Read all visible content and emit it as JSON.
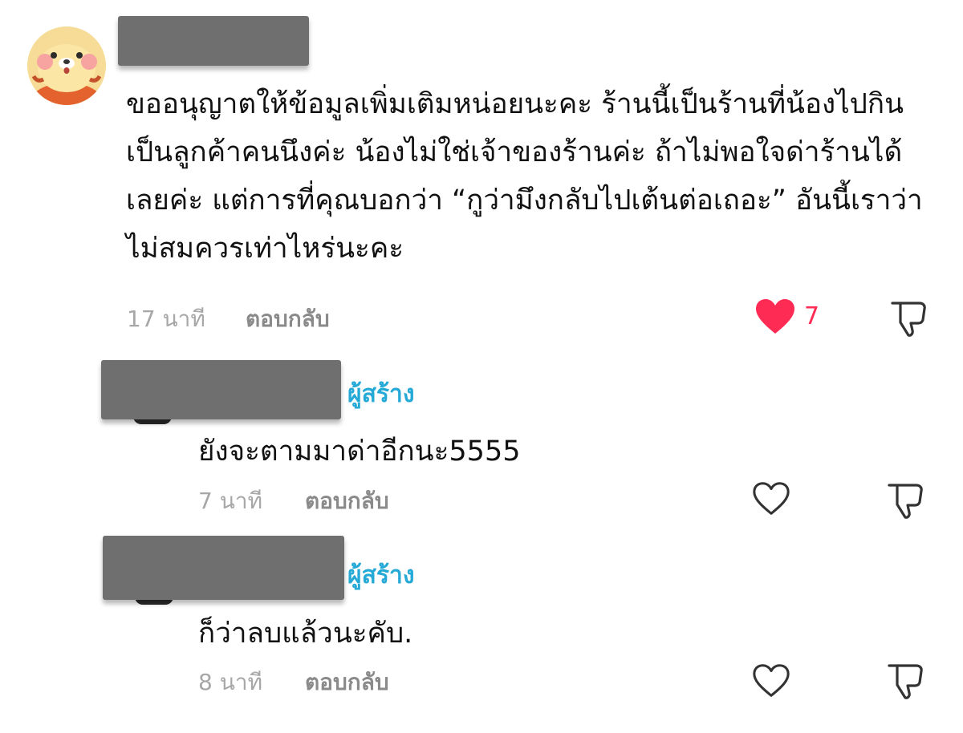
{
  "comment": {
    "avatar_icon": "cartoon-animal-avatar",
    "text": "ขออนุญาตให้ข้อมูลเพิ่มเติมหน่อยนะคะ ร้านนี้เป็นร้านที่น้องไปกิน เป็นลูกค้าคนนึงค่ะ น้องไม่ใช่เจ้าของร้านค่ะ ถ้าไม่พอใจด่าร้านได้เลยค่ะ แต่การที่คุณบอกว่า “กูว่ามึงกลับไปเต้นต่อเถอะ” อันนี้เราว่าไม่สมควรเท่าไหร่นะคะ",
    "time": "17 นาที",
    "reply_label": "ตอบกลับ",
    "like_count": "7",
    "liked": true
  },
  "replies": [
    {
      "creator_label": "ผู้สร้าง",
      "text": "ยังจะตามมาด่าอีกนะ5555",
      "time": "7 นาที",
      "reply_label": "ตอบกลับ",
      "liked": false
    },
    {
      "creator_label": "ผู้สร้าง",
      "text": "ก็ว่าลบแล้วนะคับ.",
      "time": "8 นาที",
      "reply_label": "ตอบกลับ",
      "liked": false
    }
  ],
  "colors": {
    "like_active": "#fe2c55",
    "creator_badge": "#25a9d6",
    "meta_text": "#a7a7a7",
    "redaction": "#6f6f6f"
  }
}
